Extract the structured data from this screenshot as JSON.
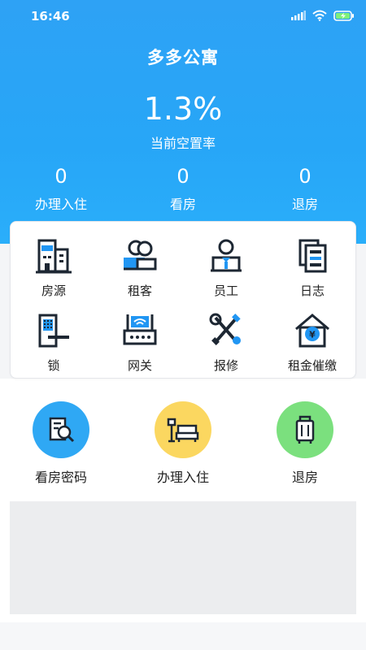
{
  "status_bar": {
    "time": "16:46"
  },
  "app": {
    "title": "多多公寓"
  },
  "summary": {
    "vacancy_rate": "1.3%",
    "vacancy_label": "当前空置率"
  },
  "stats": [
    {
      "value": "0",
      "label": "办理入住"
    },
    {
      "value": "0",
      "label": "看房"
    },
    {
      "value": "0",
      "label": "退房"
    }
  ],
  "menu": [
    {
      "label": "房源",
      "icon": "building-icon"
    },
    {
      "label": "租客",
      "icon": "tenants-icon"
    },
    {
      "label": "员工",
      "icon": "staff-icon"
    },
    {
      "label": "日志",
      "icon": "log-icon"
    },
    {
      "label": "锁",
      "icon": "lock-icon"
    },
    {
      "label": "网关",
      "icon": "gateway-icon"
    },
    {
      "label": "报修",
      "icon": "repair-icon"
    },
    {
      "label": "租金催缴",
      "icon": "rent-reminder-icon"
    }
  ],
  "quick_actions": [
    {
      "label": "看房密码",
      "icon": "viewing-password-icon",
      "color": "#2fa8f4"
    },
    {
      "label": "办理入住",
      "icon": "checkin-icon",
      "color": "#fbd760"
    },
    {
      "label": "退房",
      "icon": "checkout-icon",
      "color": "#7be07e"
    }
  ],
  "colors": {
    "header": "#2ea2f5",
    "accent_blue": "#2196f3",
    "icon_dark": "#1d2733"
  }
}
